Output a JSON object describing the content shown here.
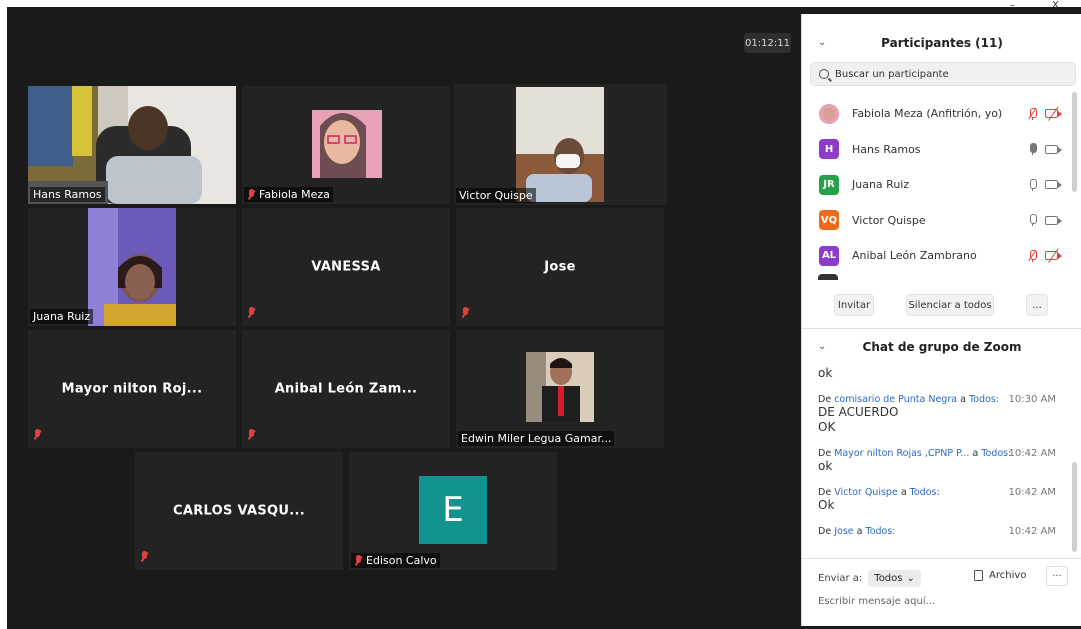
{
  "meeting": {
    "timer": "01:12:11"
  },
  "tiles": [
    {
      "name": "Hans Ramos",
      "label": "Hans Ramos",
      "video": true
    },
    {
      "name": "Fabiola Meza",
      "label": "Fabiola Meza",
      "video": true
    },
    {
      "name": "Victor Quispe",
      "label": "Victor Quispe",
      "video": true,
      "active": true
    },
    {
      "name": "Juana Ruiz",
      "label": "Juana Ruiz",
      "video": true
    },
    {
      "name": "VANESSA",
      "label": "",
      "video": false
    },
    {
      "name": "Jose",
      "label": "",
      "video": false
    },
    {
      "name": "Mayor nilton Roj...",
      "label": "",
      "video": false
    },
    {
      "name": "Anibal León Zam...",
      "label": "",
      "video": false
    },
    {
      "name": "Edwin Miler Legua Gamar...",
      "label": "Edwin Miler Legua Gamar...",
      "video": true
    },
    {
      "name": "CARLOS VASQU...",
      "label": "",
      "video": false
    },
    {
      "name": "Edison Calvo",
      "label": "Edison Calvo",
      "initial": "E"
    }
  ],
  "participants": {
    "title": "Participantes (11)",
    "search_placeholder": "Buscar un participante",
    "list": [
      {
        "name": "Fabiola Meza (Anfitrión, yo)",
        "initials": "",
        "color": "#e7a2b8",
        "mic": "muted",
        "cam": "off"
      },
      {
        "name": "Hans Ramos",
        "initials": "H",
        "color": "#8e3bc8",
        "mic": "active",
        "cam": "on"
      },
      {
        "name": "Juana Ruiz",
        "initials": "JR",
        "color": "#27a14a",
        "mic": "on",
        "cam": "on"
      },
      {
        "name": "Victor Quispe",
        "initials": "VQ",
        "color": "#ec6a1a",
        "mic": "on",
        "cam": "on"
      },
      {
        "name": "Anibal León Zambrano",
        "initials": "AL",
        "color": "#8e3bc8",
        "mic": "muted",
        "cam": "off"
      }
    ],
    "invite_label": "Invitar",
    "mute_all_label": "Silenciar a todos",
    "more_label": "..."
  },
  "chat": {
    "title": "Chat de grupo de Zoom",
    "messages": [
      {
        "body": "ok"
      },
      {
        "from": "comisario de Punta Negra",
        "to": "Todos:",
        "time": "10:30 AM",
        "lines": [
          "DE ACUERDO",
          "OK"
        ]
      },
      {
        "from": "Mayor nilton Rojas ,CPNP P...",
        "to": "Todos:",
        "time": "10:42 AM",
        "lines": [
          "ok"
        ]
      },
      {
        "from": "Victor Quispe",
        "to": "Todos:",
        "time": "10:42 AM",
        "lines": [
          "Ok"
        ]
      },
      {
        "from": "Jose",
        "to": "Todos:",
        "time": "10:42 AM",
        "lines": []
      }
    ],
    "de": "De",
    "a": "a",
    "send_to_label": "Enviar a:",
    "send_to_value": "Todos",
    "file_label": "Archivo",
    "more_label": "···",
    "compose_placeholder": "Escribir mensaje aquí..."
  },
  "window": {
    "minimize": "–",
    "close": "X"
  }
}
